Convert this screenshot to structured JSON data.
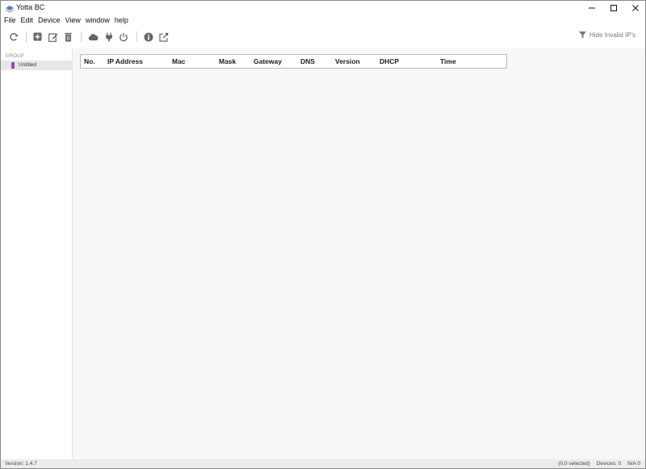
{
  "window": {
    "title": "Yotta BC"
  },
  "menu": [
    "File",
    "Edit",
    "Device",
    "View",
    "window",
    "help"
  ],
  "toolbar": {
    "filter_label": "Hide Invalid IP's"
  },
  "sidebar": {
    "header": "GROUP",
    "items": [
      {
        "label": "Untitled",
        "color": "#9b3fc4"
      }
    ]
  },
  "table": {
    "columns": [
      "No.",
      "IP Address",
      "Mac",
      "Mask",
      "Gateway",
      "DNS",
      "Version",
      "DHCP",
      "Time"
    ],
    "rows": []
  },
  "status": {
    "version": "Version: 1.4.7",
    "selected": "(0,0 selected)",
    "devices": "Devices: 0",
    "na": "N/A 0"
  },
  "icons": {
    "toolbar": [
      "refresh-icon",
      "add-icon",
      "edit-icon",
      "delete-icon",
      "cloud-icon",
      "plug-icon",
      "power-icon",
      "info-icon",
      "external-link-icon"
    ],
    "filter": "filter-icon"
  }
}
